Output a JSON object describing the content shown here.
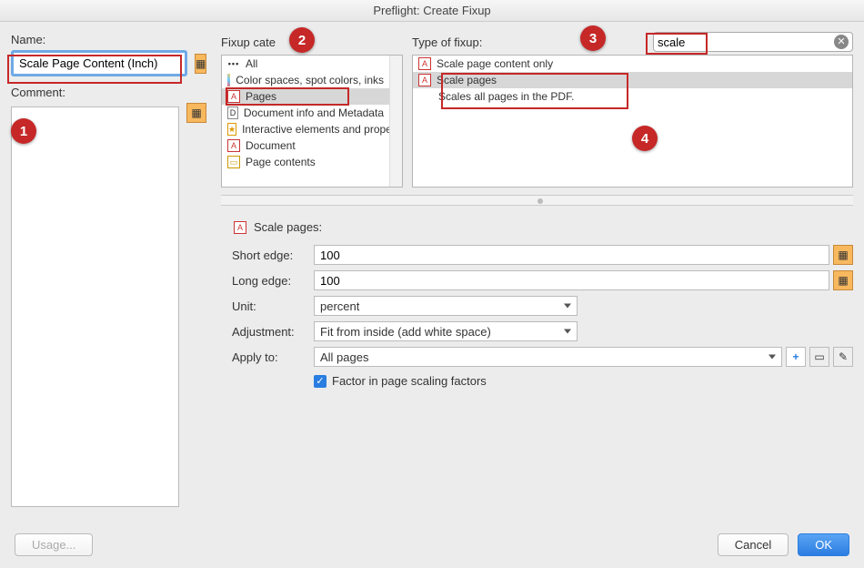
{
  "window": {
    "title": "Preflight: Create Fixup"
  },
  "left": {
    "name_label": "Name:",
    "name_value": "Scale Page Content (Inch)",
    "comment_label": "Comment:"
  },
  "categories": {
    "label": "Fixup cate",
    "items": [
      {
        "icon": "dots",
        "label": "All"
      },
      {
        "icon": "color",
        "label": "Color spaces, spot colors, inks"
      },
      {
        "icon": "pdf",
        "label": "Pages",
        "selected": true
      },
      {
        "icon": "doc",
        "label": "Document info and Metadata"
      },
      {
        "icon": "int",
        "label": "Interactive elements and proper"
      },
      {
        "icon": "pdf",
        "label": "Document"
      },
      {
        "icon": "cont",
        "label": "Page contents"
      }
    ]
  },
  "fixuptype": {
    "label": "Type of fixup:",
    "search": "scale",
    "items": [
      {
        "label": "Scale page content only",
        "selected": false
      },
      {
        "label": "Scale pages",
        "selected": true,
        "sub": "Scales all pages in the PDF."
      }
    ]
  },
  "section": {
    "title": "Scale pages:"
  },
  "form": {
    "short_edge_label": "Short edge:",
    "short_edge_value": "100",
    "long_edge_label": "Long edge:",
    "long_edge_value": "100",
    "unit_label": "Unit:",
    "unit_value": "percent",
    "adjustment_label": "Adjustment:",
    "adjustment_value": "Fit from inside (add white space)",
    "apply_label": "Apply to:",
    "apply_value": "All pages",
    "checkbox_label": "Factor in page scaling factors",
    "checkbox_checked": true
  },
  "buttons": {
    "usage": "Usage...",
    "cancel": "Cancel",
    "ok": "OK"
  },
  "callouts": {
    "1": "1",
    "2": "2",
    "3": "3",
    "4": "4"
  }
}
